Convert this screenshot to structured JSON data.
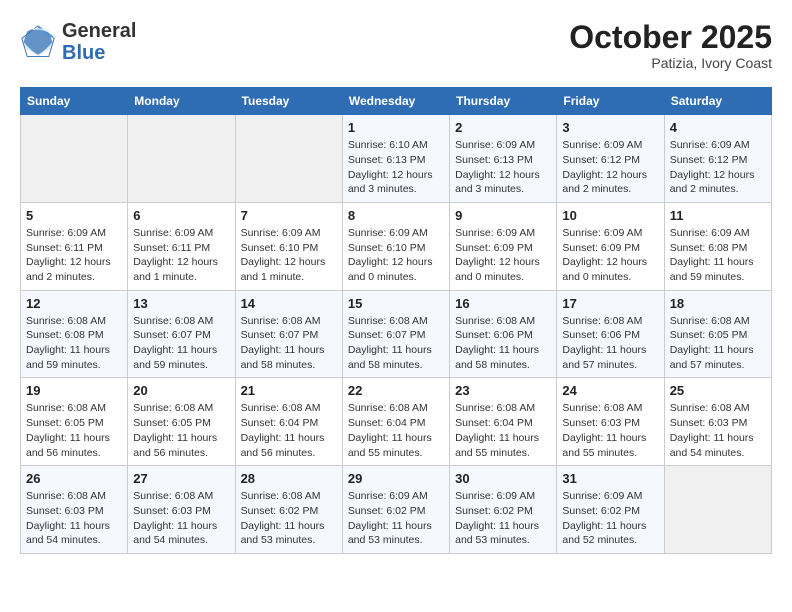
{
  "header": {
    "logo_general": "General",
    "logo_blue": "Blue",
    "month": "October 2025",
    "location": "Patizia, Ivory Coast"
  },
  "days_of_week": [
    "Sunday",
    "Monday",
    "Tuesday",
    "Wednesday",
    "Thursday",
    "Friday",
    "Saturday"
  ],
  "weeks": [
    [
      {
        "day": "",
        "info": ""
      },
      {
        "day": "",
        "info": ""
      },
      {
        "day": "",
        "info": ""
      },
      {
        "day": "1",
        "info": "Sunrise: 6:10 AM\nSunset: 6:13 PM\nDaylight: 12 hours and 3 minutes."
      },
      {
        "day": "2",
        "info": "Sunrise: 6:09 AM\nSunset: 6:13 PM\nDaylight: 12 hours and 3 minutes."
      },
      {
        "day": "3",
        "info": "Sunrise: 6:09 AM\nSunset: 6:12 PM\nDaylight: 12 hours and 2 minutes."
      },
      {
        "day": "4",
        "info": "Sunrise: 6:09 AM\nSunset: 6:12 PM\nDaylight: 12 hours and 2 minutes."
      }
    ],
    [
      {
        "day": "5",
        "info": "Sunrise: 6:09 AM\nSunset: 6:11 PM\nDaylight: 12 hours and 2 minutes."
      },
      {
        "day": "6",
        "info": "Sunrise: 6:09 AM\nSunset: 6:11 PM\nDaylight: 12 hours and 1 minute."
      },
      {
        "day": "7",
        "info": "Sunrise: 6:09 AM\nSunset: 6:10 PM\nDaylight: 12 hours and 1 minute."
      },
      {
        "day": "8",
        "info": "Sunrise: 6:09 AM\nSunset: 6:10 PM\nDaylight: 12 hours and 0 minutes."
      },
      {
        "day": "9",
        "info": "Sunrise: 6:09 AM\nSunset: 6:09 PM\nDaylight: 12 hours and 0 minutes."
      },
      {
        "day": "10",
        "info": "Sunrise: 6:09 AM\nSunset: 6:09 PM\nDaylight: 12 hours and 0 minutes."
      },
      {
        "day": "11",
        "info": "Sunrise: 6:09 AM\nSunset: 6:08 PM\nDaylight: 11 hours and 59 minutes."
      }
    ],
    [
      {
        "day": "12",
        "info": "Sunrise: 6:08 AM\nSunset: 6:08 PM\nDaylight: 11 hours and 59 minutes."
      },
      {
        "day": "13",
        "info": "Sunrise: 6:08 AM\nSunset: 6:07 PM\nDaylight: 11 hours and 59 minutes."
      },
      {
        "day": "14",
        "info": "Sunrise: 6:08 AM\nSunset: 6:07 PM\nDaylight: 11 hours and 58 minutes."
      },
      {
        "day": "15",
        "info": "Sunrise: 6:08 AM\nSunset: 6:07 PM\nDaylight: 11 hours and 58 minutes."
      },
      {
        "day": "16",
        "info": "Sunrise: 6:08 AM\nSunset: 6:06 PM\nDaylight: 11 hours and 58 minutes."
      },
      {
        "day": "17",
        "info": "Sunrise: 6:08 AM\nSunset: 6:06 PM\nDaylight: 11 hours and 57 minutes."
      },
      {
        "day": "18",
        "info": "Sunrise: 6:08 AM\nSunset: 6:05 PM\nDaylight: 11 hours and 57 minutes."
      }
    ],
    [
      {
        "day": "19",
        "info": "Sunrise: 6:08 AM\nSunset: 6:05 PM\nDaylight: 11 hours and 56 minutes."
      },
      {
        "day": "20",
        "info": "Sunrise: 6:08 AM\nSunset: 6:05 PM\nDaylight: 11 hours and 56 minutes."
      },
      {
        "day": "21",
        "info": "Sunrise: 6:08 AM\nSunset: 6:04 PM\nDaylight: 11 hours and 56 minutes."
      },
      {
        "day": "22",
        "info": "Sunrise: 6:08 AM\nSunset: 6:04 PM\nDaylight: 11 hours and 55 minutes."
      },
      {
        "day": "23",
        "info": "Sunrise: 6:08 AM\nSunset: 6:04 PM\nDaylight: 11 hours and 55 minutes."
      },
      {
        "day": "24",
        "info": "Sunrise: 6:08 AM\nSunset: 6:03 PM\nDaylight: 11 hours and 55 minutes."
      },
      {
        "day": "25",
        "info": "Sunrise: 6:08 AM\nSunset: 6:03 PM\nDaylight: 11 hours and 54 minutes."
      }
    ],
    [
      {
        "day": "26",
        "info": "Sunrise: 6:08 AM\nSunset: 6:03 PM\nDaylight: 11 hours and 54 minutes."
      },
      {
        "day": "27",
        "info": "Sunrise: 6:08 AM\nSunset: 6:03 PM\nDaylight: 11 hours and 54 minutes."
      },
      {
        "day": "28",
        "info": "Sunrise: 6:08 AM\nSunset: 6:02 PM\nDaylight: 11 hours and 53 minutes."
      },
      {
        "day": "29",
        "info": "Sunrise: 6:09 AM\nSunset: 6:02 PM\nDaylight: 11 hours and 53 minutes."
      },
      {
        "day": "30",
        "info": "Sunrise: 6:09 AM\nSunset: 6:02 PM\nDaylight: 11 hours and 53 minutes."
      },
      {
        "day": "31",
        "info": "Sunrise: 6:09 AM\nSunset: 6:02 PM\nDaylight: 11 hours and 52 minutes."
      },
      {
        "day": "",
        "info": ""
      }
    ]
  ]
}
